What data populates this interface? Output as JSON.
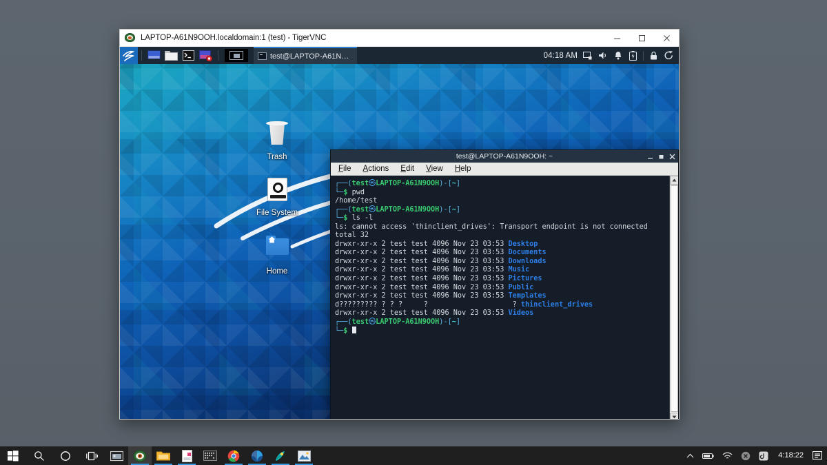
{
  "vnc_window": {
    "title": "LAPTOP-A61N9OOH.localdomain:1 (test) - TigerVNC",
    "app_icon": "tigervnc-eye-icon",
    "minimize_label": "–",
    "maximize_label": "□",
    "close_label": "✕"
  },
  "kali_panel": {
    "menu_icon": "kali-dragon-menu-icon",
    "launchers": [
      {
        "name": "show-desktop-launcher",
        "icon": "display-icon"
      },
      {
        "name": "file-manager-launcher",
        "icon": "folder-icon"
      },
      {
        "name": "terminal-launcher",
        "icon": "terminal-icon"
      },
      {
        "name": "terminal-record-launcher",
        "icon": "terminal-record-icon"
      }
    ],
    "workspace_switcher": "workspace-switcher-icon",
    "window_buttons": [
      {
        "label": "test@LAPTOP-A61N9O…",
        "icon": "terminal-icon",
        "active": true
      }
    ],
    "clock": "04:18 AM",
    "tray_icons": [
      "display-settings-icon",
      "volume-icon",
      "notification-bell-icon",
      "battery-icon",
      "lock-icon",
      "power-icon"
    ]
  },
  "desktop_icons": [
    {
      "label": "Trash",
      "icon": "trash-icon"
    },
    {
      "label": "File System",
      "icon": "drive-icon"
    },
    {
      "label": "Home",
      "icon": "home-folder-icon"
    }
  ],
  "terminal": {
    "title": "test@LAPTOP-A61N9OOH: ~",
    "minimize_label": "–",
    "maximize_label": "■",
    "close_label": "✕",
    "menus": [
      {
        "label": "File",
        "accel": "F",
        "rest": "ile"
      },
      {
        "label": "Actions",
        "accel": "A",
        "rest": "ctions"
      },
      {
        "label": "Edit",
        "accel": "E",
        "rest": "dit"
      },
      {
        "label": "View",
        "accel": "V",
        "rest": "iew"
      },
      {
        "label": "Help",
        "accel": "H",
        "rest": "elp"
      }
    ],
    "user": "test",
    "host": "LAPTOP-A61N9OOH",
    "cwd_short": "~",
    "commands": {
      "first": "pwd",
      "second": "ls -l"
    },
    "output": {
      "pwd_result": "/home/test",
      "error_line": "ls: cannot access 'thinclient_drives': Transport endpoint is not connected",
      "total_line": "total 32"
    },
    "listing": [
      {
        "perms": "drwxr-xr-x",
        "links": "2",
        "owner": "test",
        "group": "test",
        "size": "4096",
        "month": "Nov",
        "day": "23",
        "time": "03:53",
        "name": "Desktop"
      },
      {
        "perms": "drwxr-xr-x",
        "links": "2",
        "owner": "test",
        "group": "test",
        "size": "4096",
        "month": "Nov",
        "day": "23",
        "time": "03:53",
        "name": "Documents"
      },
      {
        "perms": "drwxr-xr-x",
        "links": "2",
        "owner": "test",
        "group": "test",
        "size": "4096",
        "month": "Nov",
        "day": "23",
        "time": "03:53",
        "name": "Downloads"
      },
      {
        "perms": "drwxr-xr-x",
        "links": "2",
        "owner": "test",
        "group": "test",
        "size": "4096",
        "month": "Nov",
        "day": "23",
        "time": "03:53",
        "name": "Music"
      },
      {
        "perms": "drwxr-xr-x",
        "links": "2",
        "owner": "test",
        "group": "test",
        "size": "4096",
        "month": "Nov",
        "day": "23",
        "time": "03:53",
        "name": "Pictures"
      },
      {
        "perms": "drwxr-xr-x",
        "links": "2",
        "owner": "test",
        "group": "test",
        "size": "4096",
        "month": "Nov",
        "day": "23",
        "time": "03:53",
        "name": "Public"
      },
      {
        "perms": "drwxr-xr-x",
        "links": "2",
        "owner": "test",
        "group": "test",
        "size": "4096",
        "month": "Nov",
        "day": "23",
        "time": "03:53",
        "name": "Templates"
      },
      {
        "perms": "d?????????",
        "links": "?",
        "owner": "?",
        "group": "?",
        "size": "?",
        "month": "",
        "day": "",
        "time": "?",
        "name": "thinclient_drives"
      },
      {
        "perms": "drwxr-xr-x",
        "links": "2",
        "owner": "test",
        "group": "test",
        "size": "4096",
        "month": "Nov",
        "day": "23",
        "time": "03:53",
        "name": "Videos"
      }
    ],
    "colors": {
      "background": "#141d28",
      "foreground": "#d6dbe0",
      "dir_blue": "#2f7fe8",
      "user_green": "#3bcb70",
      "prompt_blue": "#5fb4e8",
      "tilde_cyan": "#4fd6d6"
    }
  },
  "windows_taskbar": {
    "system_buttons": [
      {
        "name": "start-button",
        "icon": "windows-logo-icon"
      },
      {
        "name": "search-button",
        "icon": "search-icon"
      },
      {
        "name": "cortana-button",
        "icon": "cortana-circle-icon"
      },
      {
        "name": "task-view-button",
        "icon": "task-view-icon"
      }
    ],
    "apps": [
      {
        "name": "taskbar-app-media",
        "icon": "media-window-icon",
        "active": false,
        "running": false
      },
      {
        "name": "taskbar-app-tigervnc",
        "icon": "tigervnc-eye-icon",
        "active": true,
        "running": true
      },
      {
        "name": "taskbar-app-file-explorer",
        "icon": "folder-icon",
        "active": false,
        "running": true
      },
      {
        "name": "taskbar-app-notepad",
        "icon": "document-icon",
        "active": false,
        "running": true
      },
      {
        "name": "taskbar-app-terminal",
        "icon": "console-icon",
        "active": false,
        "running": false
      },
      {
        "name": "taskbar-app-chrome",
        "icon": "chrome-icon",
        "active": false,
        "running": true
      },
      {
        "name": "taskbar-app-outlook",
        "icon": "outlook-icon",
        "active": false,
        "running": true
      },
      {
        "name": "taskbar-app-teal",
        "icon": "compass-icon",
        "active": false,
        "running": true
      },
      {
        "name": "taskbar-app-photos",
        "icon": "photos-icon",
        "active": false,
        "running": true
      }
    ],
    "tray": [
      {
        "name": "show-hidden-icons-button",
        "icon": "chevron-up-icon"
      },
      {
        "name": "battery-tray-icon",
        "icon": "battery-icon"
      },
      {
        "name": "network-tray-icon",
        "icon": "wifi-icon"
      },
      {
        "name": "error-tray-icon",
        "icon": "x-circle-icon"
      },
      {
        "name": "app-tray-icon",
        "icon": "circle-app-icon"
      }
    ],
    "clock": "4:18:22",
    "notification_icon": "action-center-icon"
  }
}
